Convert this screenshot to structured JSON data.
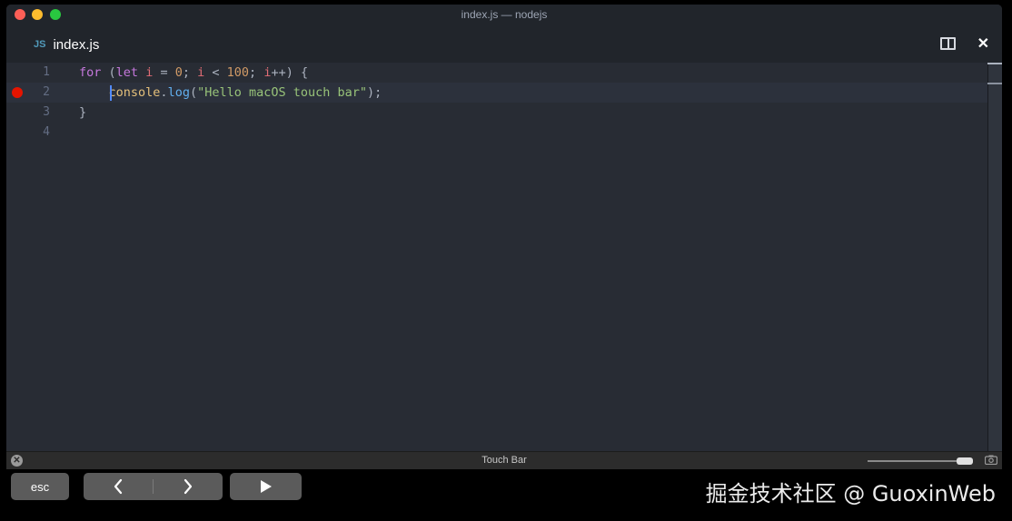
{
  "window": {
    "title": "index.js — nodejs"
  },
  "tab": {
    "icon_text": "JS",
    "label": "index.js",
    "close_glyph": "✕"
  },
  "gutter": {
    "line_numbers": [
      "1",
      "2",
      "3",
      "4"
    ]
  },
  "code": {
    "line1": {
      "for": "for",
      "open_paren": " (",
      "let": "let",
      "sp1": " ",
      "i1": "i",
      "eq": " = ",
      "zero": "0",
      "semi1": "; ",
      "i2": "i",
      "lt": " < ",
      "hundred": "100",
      "semi2": "; ",
      "i3": "i",
      "rest": "++) {"
    },
    "line2": {
      "indent": "    ",
      "console": "console",
      "dot": ".",
      "log": "log",
      "open": "(",
      "string": "\"Hello macOS touch bar\"",
      "close": ");"
    },
    "line3": {
      "brace": "}"
    }
  },
  "touchbar_header": {
    "title": "Touch Bar",
    "close_glyph": "✕"
  },
  "touchbar": {
    "esc_label": "esc",
    "back_glyph": "❮",
    "forward_glyph": "❯",
    "run_glyph": "▶"
  },
  "watermark": {
    "text": "掘金技术社区 @ GuoxinWeb"
  },
  "colors": {
    "editor_bg": "#282c34",
    "keyword": "#c678dd",
    "variable": "#e06c75",
    "number": "#d19a66",
    "string": "#98c379",
    "function": "#61afef",
    "object": "#e5c07b",
    "breakpoint": "#e51400"
  }
}
